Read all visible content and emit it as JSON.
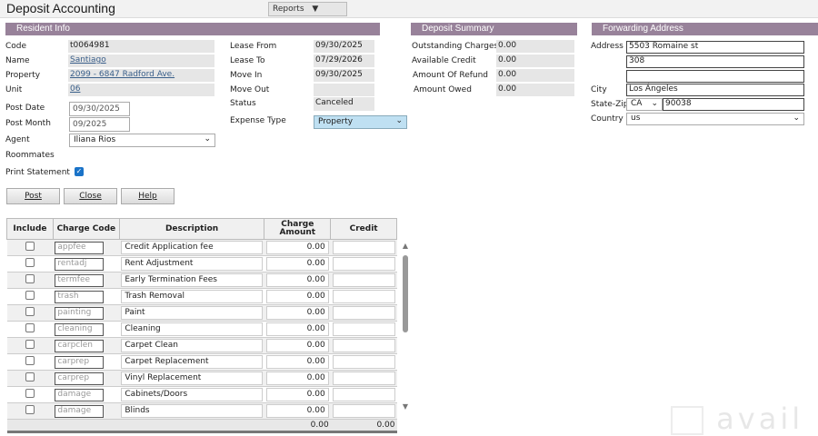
{
  "header": {
    "title": "Deposit Accounting",
    "reports_label": "Reports"
  },
  "resident": {
    "section": "Resident Info",
    "code_label": "Code",
    "code": "t0064981",
    "name_label": "Name",
    "name": "Santiago",
    "property_label": "Property",
    "property": "2099 - 6847 Radford Ave.",
    "unit_label": "Unit",
    "unit": "06",
    "post_date_label": "Post Date",
    "post_date": "09/30/2025",
    "post_month_label": "Post Month",
    "post_month": "09/2025",
    "agent_label": "Agent",
    "agent": "Iliana Rios",
    "roommates_label": "Roommates",
    "print_label": "Print Statement",
    "lease_from_label": "Lease From",
    "lease_from": "09/30/2025",
    "lease_to_label": "Lease To",
    "lease_to": "07/29/2026",
    "move_in_label": "Move In",
    "move_in": "09/30/2025",
    "move_out_label": "Move Out",
    "move_out": "",
    "status_label": "Status",
    "status": "Canceled",
    "expense_label": "Expense Type",
    "expense": "Property"
  },
  "summary": {
    "section": "Deposit Summary",
    "outstanding_label": "Outstanding Charges",
    "outstanding": "0.00",
    "credit_label": "Available Credit",
    "credit": "0.00",
    "refund_label": "Amount Of Refund",
    "refund": "0.00",
    "owed_label": "Amount Owed",
    "owed": "0.00"
  },
  "forwarding": {
    "section": "Forwarding Address",
    "address_label": "Address",
    "address1": "5503 Romaine st",
    "address2": "308",
    "address3": "",
    "city_label": "City",
    "city": "Los Ángeles",
    "statezip_label": "State-Zip",
    "state": "CA",
    "zip": "90038",
    "country_label": "Country",
    "country": "us"
  },
  "buttons": {
    "post": "Post",
    "close": "Close",
    "help": "Help"
  },
  "table": {
    "headers": [
      "Include",
      "Charge Code",
      "Description",
      "Charge Amount",
      "Credit"
    ],
    "rows": [
      {
        "code": "appfee",
        "desc": "Credit Application fee",
        "amount": "0.00"
      },
      {
        "code": "rentadj",
        "desc": "Rent Adjustment",
        "amount": "0.00"
      },
      {
        "code": "termfee",
        "desc": "Early Termination Fees",
        "amount": "0.00"
      },
      {
        "code": "trash",
        "desc": "Trash Removal",
        "amount": "0.00"
      },
      {
        "code": "painting",
        "desc": "Paint",
        "amount": "0.00"
      },
      {
        "code": "cleaning",
        "desc": "Cleaning",
        "amount": "0.00"
      },
      {
        "code": "carpclen",
        "desc": "Carpet Clean",
        "amount": "0.00"
      },
      {
        "code": "carprep",
        "desc": "Carpet Replacement",
        "amount": "0.00"
      },
      {
        "code": "carprep",
        "desc": "Vinyl Replacement",
        "amount": "0.00"
      },
      {
        "code": "damage",
        "desc": "Cabinets/Doors",
        "amount": "0.00"
      },
      {
        "code": "damage",
        "desc": "Blinds",
        "amount": "0.00"
      }
    ],
    "total_amount": "0.00",
    "total_credit": "0.00"
  },
  "watermark": "avail"
}
